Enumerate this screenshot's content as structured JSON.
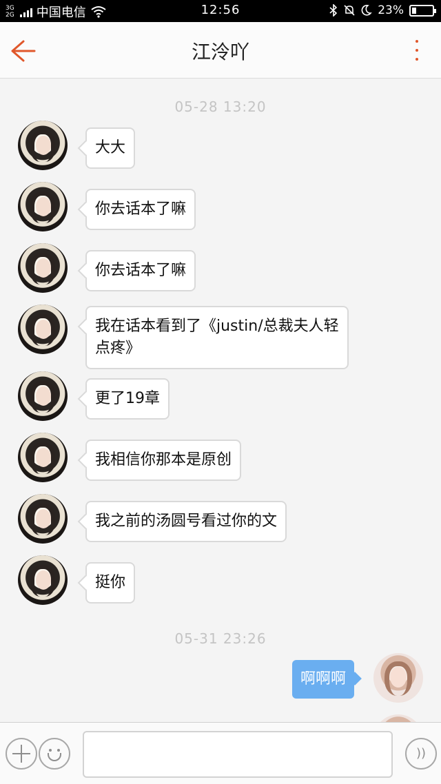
{
  "status_bar": {
    "network_top": "3G",
    "network_bottom": "2G",
    "carrier": "中国电信",
    "time": "12:56",
    "battery": "23%",
    "battery_level": 0.23
  },
  "header": {
    "back_icon": "arrow-left-icon",
    "title": "江泠吖",
    "more_icon": "more-vertical-icon",
    "accent_color": "#e0572b"
  },
  "messages": {
    "timestamp_1": "05-28 13:20",
    "incoming": [
      {
        "text": "大大"
      },
      {
        "text": "你去话本了嘛"
      },
      {
        "text": "你去话本了嘛"
      },
      {
        "text": "我在话本看到了《justin/总裁夫人轻点疼》"
      },
      {
        "text": "更了19章"
      },
      {
        "text": "我相信你那本是原创"
      },
      {
        "text": "我之前的汤圆号看过你的文"
      },
      {
        "text": "挺你"
      }
    ],
    "timestamp_2": "05-31 23:26",
    "outgoing": [
      {
        "text": "啊啊啊"
      }
    ],
    "outgoing_color": "#6aaef0"
  },
  "input_bar": {
    "plus_icon": "plus-icon",
    "emoji_icon": "smile-icon",
    "voice_icon": "voice-icon",
    "voice_glyph": "))",
    "placeholder": ""
  }
}
